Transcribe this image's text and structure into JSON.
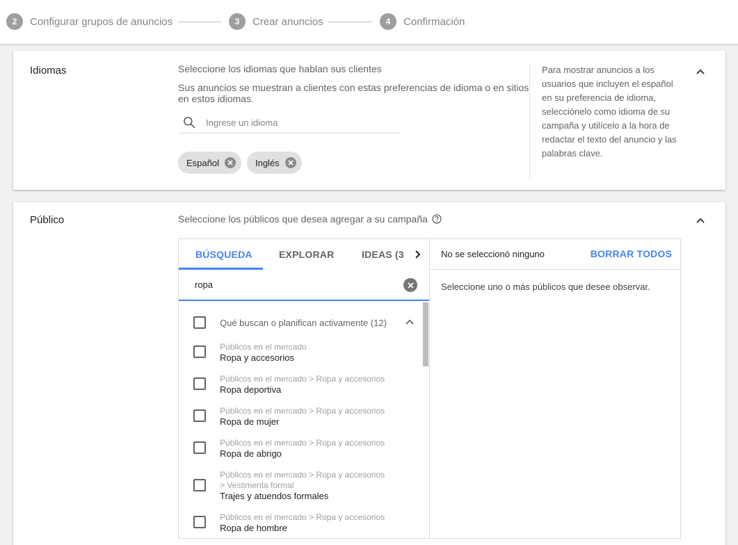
{
  "stepper": {
    "steps": [
      {
        "num": "2",
        "label": "Configurar grupos de anuncios"
      },
      {
        "num": "3",
        "label": "Crear anuncios"
      },
      {
        "num": "4",
        "label": "Confirmación"
      }
    ]
  },
  "languages": {
    "title": "Idiomas",
    "subtitle": "Seleccione los idiomas que hablan sus clientes",
    "description": "Sus anuncios se muestran a clientes con estas preferencias de idioma o en sitios en estos idiomas.",
    "search_placeholder": "Ingrese un idioma",
    "chips": [
      "Español",
      "Inglés"
    ],
    "help": "Para mostrar anuncios a los usuarios que incluyen el español en su preferencia de idioma, selecciónelo como idioma de su campaña y utilícelo a la hora de redactar el texto del anuncio y las palabras clave."
  },
  "audience": {
    "title": "Público",
    "subtitle": "Seleccione los públicos que desea agregar a su campaña",
    "tabs": [
      "BÚSQUEDA",
      "EXPLORAR",
      "IDEAS (3"
    ],
    "active_tab": "BÚSQUEDA",
    "search_value": "ropa",
    "group_label": "Qué buscan o planifican activamente (12)",
    "items": [
      {
        "path": "Públicos en el mercado",
        "path2": "",
        "name": "Ropa y accesorios"
      },
      {
        "path": "Públicos en el mercado > Ropa y accesorios",
        "path2": "",
        "name": "Ropa deportiva"
      },
      {
        "path": "Públicos en el mercado > Ropa y accesorios",
        "path2": "",
        "name": "Ropa de mujer"
      },
      {
        "path": "Públicos en el mercado > Ropa y accesorios",
        "path2": "",
        "name": "Ropa de abrigo"
      },
      {
        "path": "Públicos en el mercado > Ropa y accesorios",
        "path2": " > Vestimenta formal",
        "name": "Trajes y atuendos formales"
      },
      {
        "path": "Públicos en el mercado > Ropa y accesorios",
        "path2": "",
        "name": "Ropa de hombre"
      }
    ],
    "selected_status": "No se seleccionó ninguno",
    "clear_all": "BORRAR TODOS",
    "selected_hint": "Seleccione uno o más públicos que desee observar."
  },
  "colors": {
    "accent": "#4285f4",
    "step_circle": "#9e9e9e"
  }
}
